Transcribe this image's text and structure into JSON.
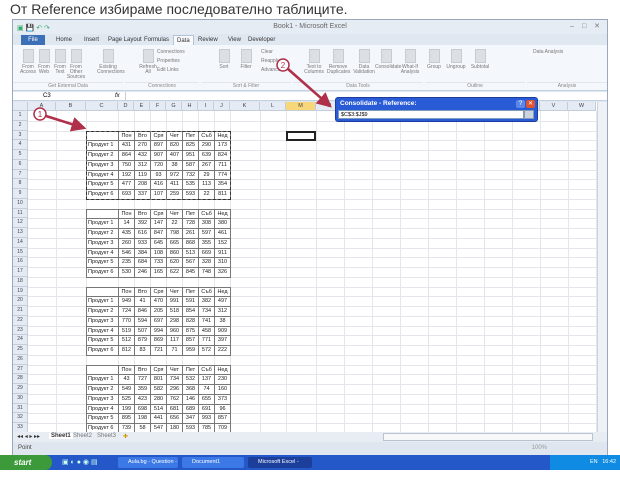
{
  "caption": "От Reference избираме последователно таблиците.",
  "window": {
    "title": "Book1 - Microsoft Excel"
  },
  "tabs": [
    "File",
    "Home",
    "Insert",
    "Page Layout",
    "Formulas",
    "Data",
    "Review",
    "View",
    "Developer"
  ],
  "active_tab": "Data",
  "ribbon": {
    "buttons": [
      "From Access",
      "From Web",
      "From Text",
      "From Other Sources",
      "Existing Connections",
      "Refresh All",
      "Sort",
      "Filter",
      "Text to Columns",
      "Remove Duplicates",
      "Data Validation",
      "Consolidate",
      "What-If Analysis",
      "Group",
      "Ungroup",
      "Subtotal"
    ],
    "small": [
      "Connections",
      "Properties",
      "Edit Links",
      "Clear",
      "Reapply",
      "Advanced",
      "Data Analysis"
    ],
    "groups": [
      "Get External Data",
      "Connections",
      "Sort & Filter",
      "Data Tools",
      "Outline",
      "Analysis"
    ]
  },
  "formula_bar": {
    "name_box": "C3",
    "fx": "fx",
    "value": ""
  },
  "columns": [
    "A",
    "B",
    "C",
    "D",
    "E",
    "F",
    "G",
    "H",
    "I",
    "J",
    "K",
    "L",
    "M",
    "N",
    "O",
    "P",
    "Q",
    "R",
    "S",
    "T",
    "U",
    "V",
    "W"
  ],
  "selected_column": "M",
  "dialog": {
    "title": "Consolidate - Reference:",
    "value": "$C$3:$J$9",
    "help": "?",
    "close": "✕"
  },
  "table_header": [
    "",
    "Пон",
    "Вто",
    "Сря",
    "Чет",
    "Пет",
    "Съб",
    "Нед"
  ],
  "tables": [
    {
      "rows": [
        [
          "Продукт 1",
          431,
          270,
          897,
          820,
          825,
          290,
          173
        ],
        [
          "Продукт 2",
          864,
          432,
          907,
          407,
          951,
          639,
          824
        ],
        [
          "Продукт 3",
          750,
          312,
          720,
          38,
          587,
          267,
          711
        ],
        [
          "Продукт 4",
          192,
          119,
          93,
          972,
          732,
          29,
          774
        ],
        [
          "Продукт 5",
          477,
          208,
          416,
          411,
          535,
          113,
          354
        ],
        [
          "Продукт 6",
          693,
          337,
          107,
          259,
          593,
          22,
          811
        ]
      ]
    },
    {
      "rows": [
        [
          "Продукт 1",
          14,
          392,
          147,
          22,
          728,
          308,
          380
        ],
        [
          "Продукт 2",
          435,
          616,
          847,
          798,
          261,
          597,
          461
        ],
        [
          "Продукт 3",
          260,
          933,
          645,
          665,
          868,
          355,
          152
        ],
        [
          "Продукт 4",
          546,
          384,
          108,
          860,
          513,
          669,
          911
        ],
        [
          "Продукт 5",
          235,
          684,
          733,
          620,
          567,
          328,
          310
        ],
        [
          "Продукт 6",
          530,
          246,
          165,
          622,
          845,
          748,
          326
        ]
      ]
    },
    {
      "rows": [
        [
          "Продукт 1",
          949,
          41,
          470,
          991,
          591,
          382,
          497
        ],
        [
          "Продукт 2",
          724,
          846,
          205,
          518,
          854,
          734,
          312
        ],
        [
          "Продукт 3",
          770,
          594,
          697,
          298,
          828,
          741,
          38
        ],
        [
          "Продукт 4",
          519,
          507,
          994,
          960,
          875,
          458,
          909
        ],
        [
          "Продукт 5",
          512,
          879,
          869,
          117,
          857,
          771,
          397
        ],
        [
          "Продукт 6",
          812,
          83,
          721,
          71,
          959,
          572,
          222
        ]
      ]
    },
    {
      "rows": [
        [
          "Продукт 1",
          43,
          727,
          801,
          734,
          532,
          137,
          230
        ],
        [
          "Продукт 2",
          549,
          359,
          582,
          296,
          368,
          74,
          160
        ],
        [
          "Продукт 3",
          525,
          423,
          280,
          762,
          146,
          655,
          373
        ],
        [
          "Продукт 4",
          199,
          698,
          514,
          681,
          689,
          691,
          96
        ],
        [
          "Продукт 5",
          895,
          198,
          441,
          656,
          347,
          993,
          857
        ],
        [
          "Продукт 6",
          739,
          58,
          547,
          180,
          593,
          785,
          709
        ]
      ]
    }
  ],
  "sheet_tabs": [
    "Sheet1",
    "Sheet2",
    "Sheet3"
  ],
  "status": {
    "mode": "Point",
    "zoom": "100%"
  },
  "annotations": [
    "1",
    "2"
  ],
  "taskbar": {
    "start": "start",
    "tasks": [
      "Aula.bg - Question - ...",
      "Document1 [Compat...",
      "Microsoft Excel - Book1"
    ],
    "lang": "EN",
    "clock": "16:42"
  },
  "colors": {
    "accent": "#2a5bd7",
    "annotation": "#b0304a",
    "taskbar": "#2457c8"
  }
}
